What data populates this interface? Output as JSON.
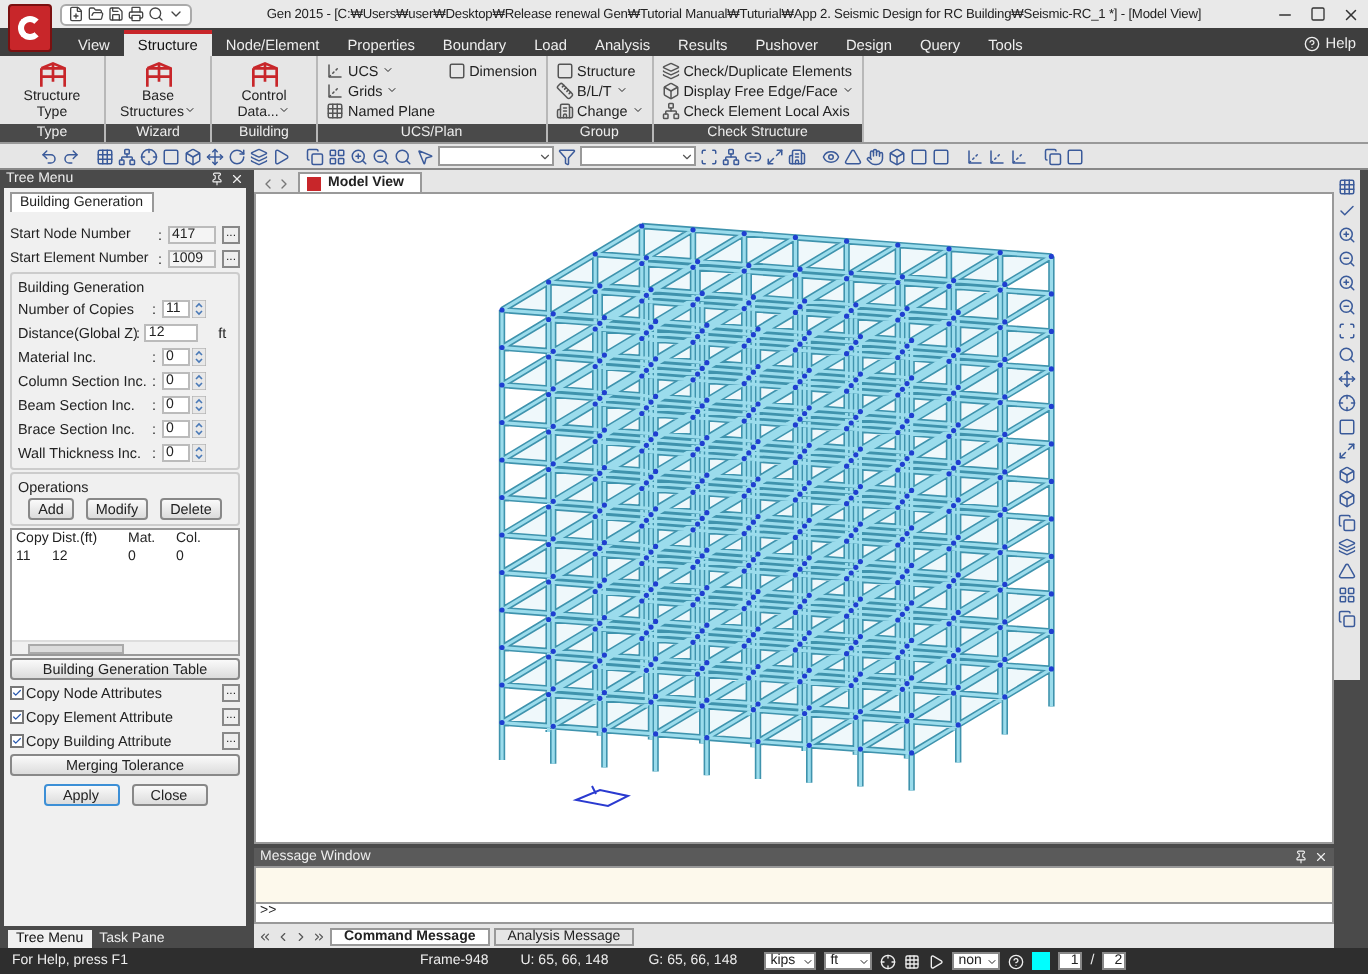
{
  "window": {
    "title": "Gen 2015 - [C:₩Users₩user₩Desktop₩Release renewal Gen₩Tutorial Manual₩Tuturial₩App 2. Seismic Design for RC Building₩Seismic-RC_1 *] - [Model View]"
  },
  "menu_tabs": [
    {
      "label": "View",
      "selected": false
    },
    {
      "label": "Structure",
      "selected": true
    },
    {
      "label": "Node/Element",
      "selected": false
    },
    {
      "label": "Properties",
      "selected": false
    },
    {
      "label": "Boundary",
      "selected": false
    },
    {
      "label": "Load",
      "selected": false
    },
    {
      "label": "Analysis",
      "selected": false
    },
    {
      "label": "Results",
      "selected": false
    },
    {
      "label": "Pushover",
      "selected": false
    },
    {
      "label": "Design",
      "selected": false
    },
    {
      "label": "Query",
      "selected": false
    },
    {
      "label": "Tools",
      "selected": false
    }
  ],
  "help": {
    "label": "Help"
  },
  "ribbon": {
    "groups": [
      {
        "title": "Type",
        "items": [
          {
            "label": "Structure Type",
            "kind": "large",
            "dropdown": false
          }
        ]
      },
      {
        "title": "Wizard",
        "items": [
          {
            "label": "Base Structures",
            "kind": "large",
            "dropdown": true
          }
        ]
      },
      {
        "title": "Building",
        "items": [
          {
            "label": "Control Data...",
            "kind": "large",
            "dropdown": true
          }
        ]
      },
      {
        "title": "UCS/Plan",
        "items": [
          {
            "label": "UCS",
            "kind": "small",
            "dropdown": true
          },
          {
            "label": "Grids",
            "kind": "small",
            "dropdown": true
          },
          {
            "label": "Named Plane",
            "kind": "small",
            "dropdown": false
          },
          {
            "label": "Dimension",
            "kind": "small",
            "dropdown": false
          }
        ]
      },
      {
        "title": "Group",
        "items": [
          {
            "label": "Structure",
            "kind": "small",
            "dropdown": false
          },
          {
            "label": "B/L/T",
            "kind": "small",
            "dropdown": true
          },
          {
            "label": "Change",
            "kind": "small",
            "dropdown": true
          }
        ]
      },
      {
        "title": "Check Structure",
        "items": [
          {
            "label": "Check/Duplicate Elements",
            "kind": "small",
            "dropdown": false
          },
          {
            "label": "Display Free Edge/Face",
            "kind": "small",
            "dropdown": true
          },
          {
            "label": "Check Element Local Axis",
            "kind": "small",
            "dropdown": false
          }
        ]
      }
    ]
  },
  "tree_menu": {
    "title": "Tree Menu",
    "tab": "Building Generation",
    "start_fields": [
      {
        "label": "Start Node Number",
        "colon": ":",
        "value": "417",
        "browse": "..."
      },
      {
        "label": "Start Element Number",
        "colon": ":",
        "value": "1009",
        "browse": "..."
      }
    ],
    "generation": {
      "title": "Building Generation",
      "fields": [
        {
          "label": "Number of Copies",
          "colon": ":",
          "value": "11",
          "kind": "spin"
        },
        {
          "label": "Distance(Global Z)",
          "colon": ":",
          "value": "12",
          "unit": "ft",
          "kind": "text"
        },
        {
          "label": "Material Inc.",
          "colon": ":",
          "value": "0",
          "kind": "spin"
        },
        {
          "label": "Column Section Inc.",
          "colon": ":",
          "value": "0",
          "kind": "spin"
        },
        {
          "label": "Beam Section Inc.",
          "colon": ":",
          "value": "0",
          "kind": "spin"
        },
        {
          "label": "Brace Section Inc.",
          "colon": ":",
          "value": "0",
          "kind": "spin"
        },
        {
          "label": "Wall Thickness Inc.",
          "colon": ":",
          "value": "0",
          "kind": "spin"
        }
      ]
    },
    "operations": {
      "title": "Operations",
      "buttons": [
        "Add",
        "Modify",
        "Delete"
      ]
    },
    "table": {
      "columns": [
        "Copy",
        "Dist.(ft)",
        "Mat.",
        "Col."
      ],
      "rows": [
        [
          "11",
          "12",
          "0",
          "0"
        ]
      ]
    },
    "table_button": "Building Generation Table",
    "options": [
      {
        "label": "Copy Node Attributes",
        "checked": true,
        "browse": "..."
      },
      {
        "label": "Copy Element Attribute",
        "checked": true,
        "browse": "..."
      },
      {
        "label": "Copy Building Attribute",
        "checked": true,
        "browse": "..."
      }
    ],
    "tolerance_button": "Merging Tolerance",
    "actions": [
      {
        "label": "Apply",
        "selected": true
      },
      {
        "label": "Close",
        "selected": false
      }
    ],
    "bottom_tabs": [
      {
        "label": "Tree Menu",
        "selected": true
      },
      {
        "label": "Task Pane",
        "selected": false
      }
    ]
  },
  "model_view": {
    "tab": "Model View"
  },
  "message_window": {
    "title": "Message Window",
    "prompt": ">>",
    "tabs": [
      {
        "label": "Command Message",
        "selected": true
      },
      {
        "label": "Analysis Message",
        "selected": false
      }
    ]
  },
  "status_bar": {
    "help": "For Help, press F1",
    "frame": "Frame-948",
    "u": "U: 65, 66, 148",
    "g": "G: 65, 66, 148",
    "force_unit": "kips",
    "length_unit": "ft",
    "snap": "non",
    "page": "1",
    "separator": "/",
    "total": "2"
  }
}
